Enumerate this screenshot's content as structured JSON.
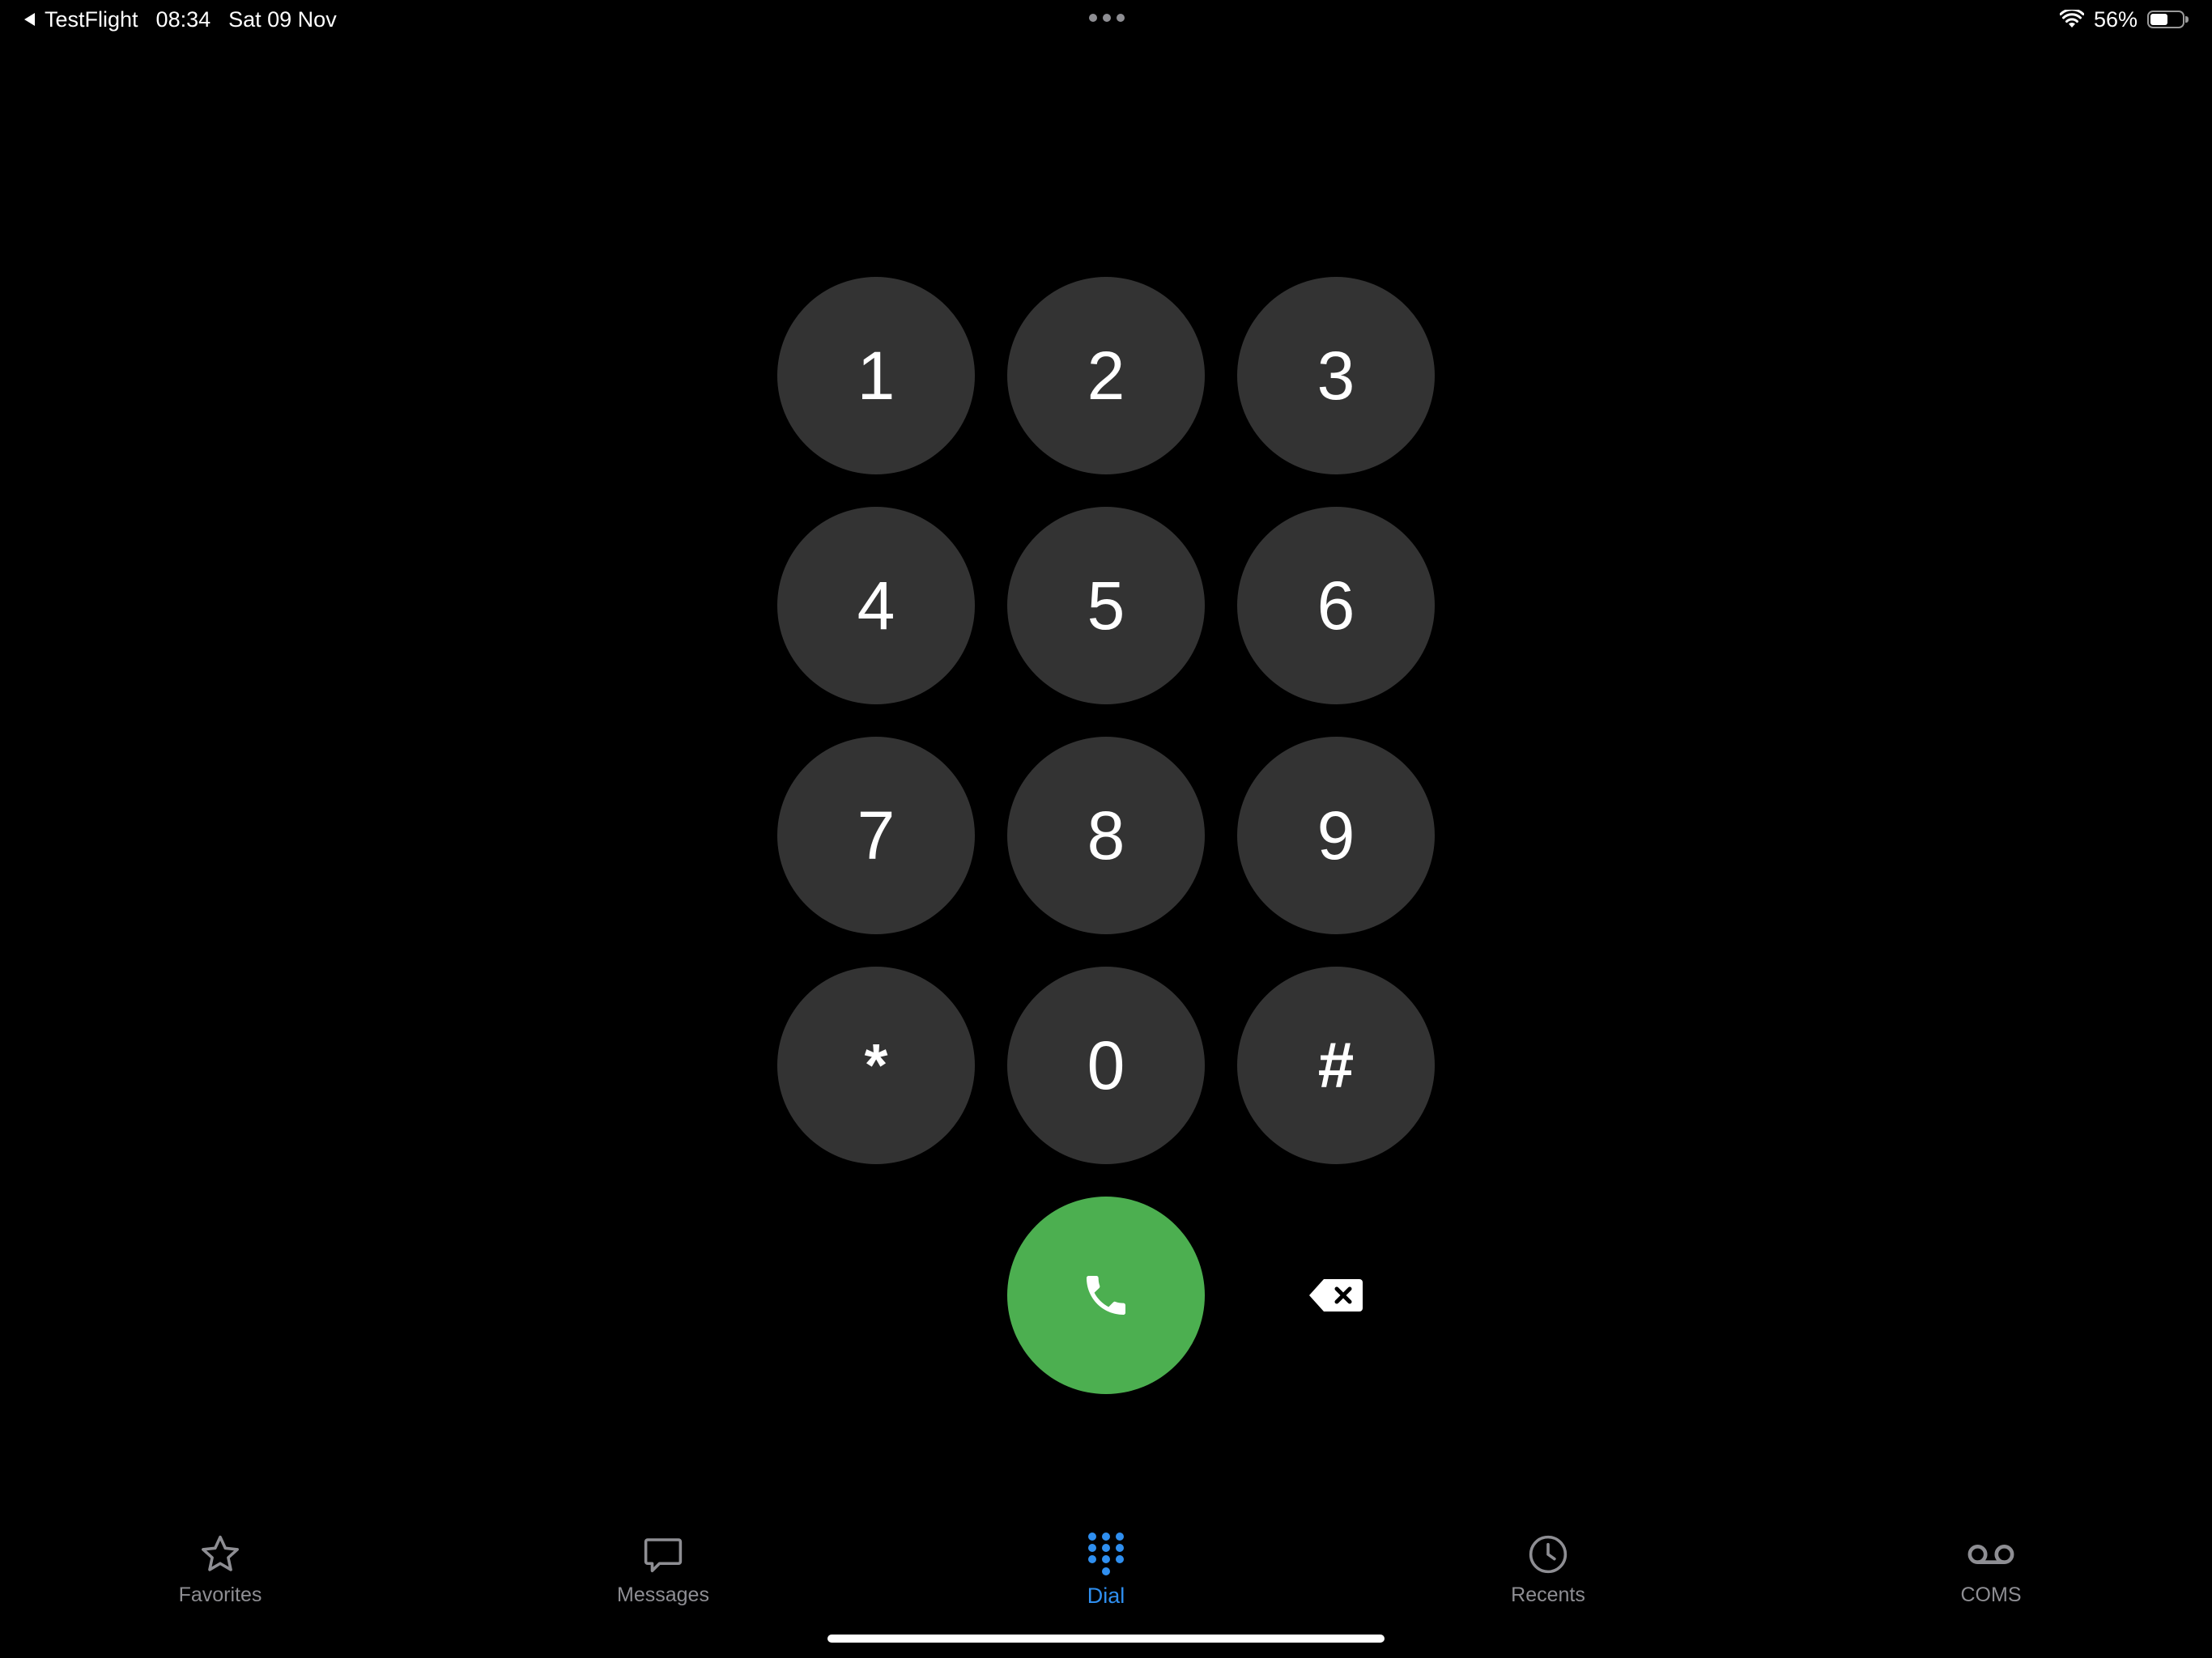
{
  "status_bar": {
    "back_app": "TestFlight",
    "time": "08:34",
    "date": "Sat 09 Nov",
    "battery_percent": "56%",
    "battery_level": 0.56
  },
  "keypad": {
    "keys": [
      "1",
      "2",
      "3",
      "4",
      "5",
      "6",
      "7",
      "8",
      "9",
      "*",
      "0",
      "#"
    ]
  },
  "tabs": [
    {
      "label": "Favorites",
      "icon": "star-icon"
    },
    {
      "label": "Messages",
      "icon": "message-bubble-icon"
    },
    {
      "label": "Dial",
      "icon": "keypad-icon",
      "active": true
    },
    {
      "label": "Recents",
      "icon": "clock-icon"
    },
    {
      "label": "COMS",
      "icon": "voicemail-icon"
    }
  ],
  "colors": {
    "background": "#000000",
    "key": "#333333",
    "call": "#4caf50",
    "active_tab": "#2f8ff0",
    "inactive_tab": "#8e8e93"
  }
}
